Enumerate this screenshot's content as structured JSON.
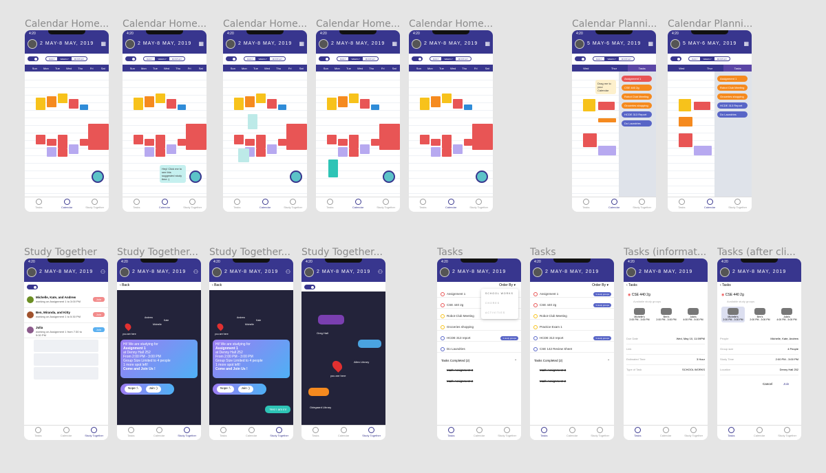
{
  "frames": [
    {
      "title": "Calendar Home..."
    },
    {
      "title": "Calendar Home..."
    },
    {
      "title": "Calendar Home..."
    },
    {
      "title": "Calendar Home..."
    },
    {
      "title": "Calendar Home..."
    },
    {
      "title": "Calendar Planni..."
    },
    {
      "title": "Calendar Planni..."
    },
    {
      "title": "Study Together"
    },
    {
      "title": "Study Together..."
    },
    {
      "title": "Study Together..."
    },
    {
      "title": "Study Together..."
    },
    {
      "title": "Tasks"
    },
    {
      "title": "Tasks"
    },
    {
      "title": "Tasks (informat..."
    },
    {
      "title": "Tasks (after cli..."
    }
  ],
  "status_time": "4:20",
  "header_week": "2 MAY-8 MAY, 2019",
  "header_planning": "5 MAY-6 MAY, 2019",
  "view_modes": [
    "DAILY",
    "WEEKLY",
    "MONTHLY"
  ],
  "days": [
    "Sun",
    "Mon",
    "Tue",
    "Wed",
    "Thu",
    "Fri",
    "Sat"
  ],
  "planning_days": [
    "Wed",
    "Thur",
    "Tasks"
  ],
  "tabs": [
    "Tasks",
    "Calendar",
    "Study Together"
  ],
  "tooltip_text": "Hey! Click me to see this suggested study time :)",
  "drag_tip": "Drag me to your Calendar",
  "planning_tasks": [
    "Assignment 1",
    "CSE 440 2g",
    "Robot Club Meeting",
    "Groceries shopping",
    "HCDE 313 Report",
    "Do Laundries"
  ],
  "planning_tasks_b": [
    "Assignment 1",
    "Robot Club Meeting",
    "Groceries shopping",
    "HCDE 313 Report",
    "Do Laundries"
  ],
  "study_list": [
    {
      "names": "Michelle, Kate, and Andrew",
      "detail": "working on Assignment 1 to 3:00 PM",
      "btn": "Join"
    },
    {
      "names": "Ben, Miranda, and Kitty",
      "detail": "working on Assignment 1 to 5:30 PM",
      "btn": "Join"
    },
    {
      "names": "Julia",
      "detail": "working on Assignment 1 from 7:30 to 9:00 PM",
      "btn": "Join"
    }
  ],
  "back_label": "Back",
  "you_are_here": "you are here",
  "map_names": [
    "Andrew",
    "Kate",
    "Michelle"
  ],
  "invite": {
    "line1": "Hi! We are studying for",
    "line2": "Assignment 1",
    "line3": "at Denny Hall 252",
    "line4": "From 2:00 PM - 3:00 PM",
    "line5": "Group Size Limited to 4 people",
    "line6": "1 more spot left!",
    "line7": "Come and Join Us !"
  },
  "nope_label": "Nope :\\",
  "join_label": "Join :)",
  "reply_label": "Yes! I am in!",
  "places": [
    "Greg Hall",
    "Allen Library",
    "Odegaard Library"
  ],
  "order_by": "Order By",
  "order_options": [
    "SCHOOL WORKS",
    "CHORES",
    "ACTIVITIES"
  ],
  "tasks_a": [
    {
      "name": "Assignment 1",
      "pill": ""
    },
    {
      "name": "CSE 440 2g",
      "pill": "3 study groups"
    },
    {
      "name": "Robot Club Meeting",
      "pill": ""
    },
    {
      "name": "Groceries shopping",
      "pill": ""
    },
    {
      "name": "HCDE 313 report",
      "pill": "3 study groups"
    },
    {
      "name": "Do Laundries",
      "pill": ""
    }
  ],
  "tasks_b": [
    {
      "name": "Assignment 1",
      "pill": "3 study groups"
    },
    {
      "name": "CSE 440 2g",
      "pill": "3 study groups"
    },
    {
      "name": "Robot Club Meeting",
      "pill": ""
    },
    {
      "name": "Practice Exam 1",
      "pill": ""
    },
    {
      "name": "HCDE 313 report",
      "pill": "3 study groups"
    },
    {
      "name": "CSE 142 Review Sheet",
      "pill": ""
    }
  ],
  "tasks_completed": "Tasks Completed (2)",
  "completed_items": [
    "Math Assignment 3",
    "Math Assignment 2"
  ],
  "tasks_back": "Tasks",
  "detail_task": "CSE 440 2g",
  "available_groups": "Available study groups",
  "group_cards": [
    {
      "name": "Michelle's",
      "time": "2:00 PM - 3:00 PM"
    },
    {
      "name": "Ben's",
      "time": "2:00 PM - 3:00 PM"
    },
    {
      "name": "Julia's",
      "time": "4:00 PM - 5:00 PM"
    }
  ],
  "info_rows": [
    {
      "label": "Due Date",
      "value": "Wed, May 10, 11:59PM"
    },
    {
      "label": "Link",
      "value": ""
    },
    {
      "label": "Estimated Time",
      "value": "3 Hour"
    },
    {
      "label": "Type of Task",
      "value": "SCHOOL WORKS"
    }
  ],
  "group_rows": [
    {
      "label": "People",
      "value": "Michelle, Kate, Andrew"
    },
    {
      "label": "Group size",
      "value": "4 People"
    },
    {
      "label": "Study Time",
      "value": "2:00 PM - 3:00 PM"
    },
    {
      "label": "Location",
      "value": "Denny Hall 252"
    }
  ],
  "cancel_label": "Cancel",
  "join_btn": "Join",
  "colors": {
    "primary": "#38368e",
    "red": "#e85555",
    "yellow": "#f7c21b",
    "orange": "#f58a1f",
    "lavender": "#b7a9f0",
    "teal": "#5cc3c8"
  }
}
